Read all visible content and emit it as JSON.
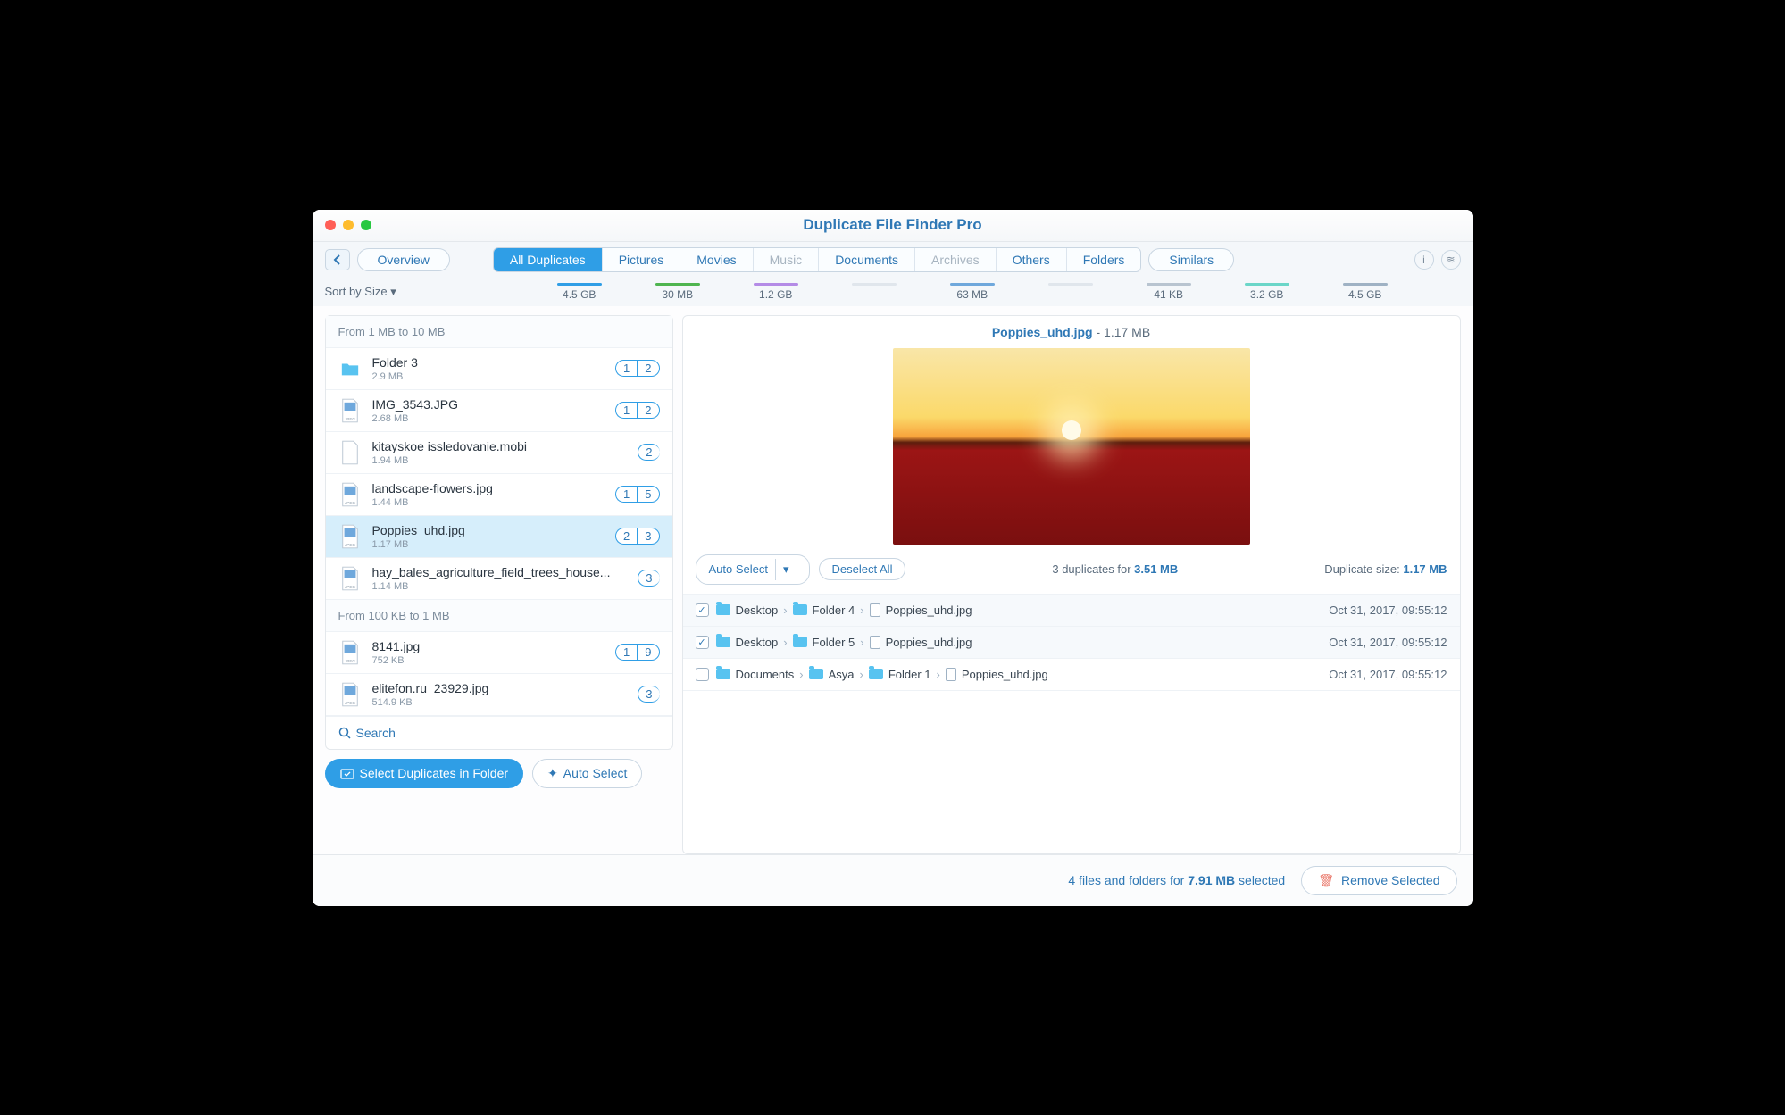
{
  "window": {
    "title": "Duplicate File Finder Pro"
  },
  "toolbar": {
    "overview": "Overview",
    "similars": "Similars",
    "tabs": [
      {
        "label": "All Duplicates",
        "size": "4.5 GB",
        "color": "#2f9ee6",
        "active": true
      },
      {
        "label": "Pictures",
        "size": "30 MB",
        "color": "#4fb54f"
      },
      {
        "label": "Movies",
        "size": "1.2 GB",
        "color": "#b48be6"
      },
      {
        "label": "Music",
        "size": "",
        "color": "#e0e6ec",
        "dim": true
      },
      {
        "label": "Documents",
        "size": "63 MB",
        "color": "#6fa8dc"
      },
      {
        "label": "Archives",
        "size": "",
        "color": "#e0e6ec",
        "dim": true
      },
      {
        "label": "Others",
        "size": "41 KB",
        "color": "#b8c4d0"
      },
      {
        "label": "Folders",
        "size": "3.2 GB",
        "color": "#6bd6c8"
      }
    ],
    "similars_size": "4.5 GB",
    "sort": "Sort by Size"
  },
  "sidebar": {
    "groups": [
      {
        "header": "From 1 MB to 10 MB",
        "items": [
          {
            "name": "Folder 3",
            "size": "2.9 MB",
            "type": "folder",
            "badge": [
              "1",
              "2"
            ]
          },
          {
            "name": "IMG_3543.JPG",
            "size": "2.68 MB",
            "type": "jpeg",
            "badge": [
              "1",
              "2"
            ]
          },
          {
            "name": "kitayskoe issledovanie.mobi",
            "size": "1.94 MB",
            "type": "doc",
            "badge": [
              "2"
            ]
          },
          {
            "name": "landscape-flowers.jpg",
            "size": "1.44 MB",
            "type": "jpeg",
            "badge": [
              "1",
              "5"
            ]
          },
          {
            "name": "Poppies_uhd.jpg",
            "size": "1.17 MB",
            "type": "jpeg",
            "badge": [
              "2",
              "3"
            ],
            "selected": true
          },
          {
            "name": "hay_bales_agriculture_field_trees_house...",
            "size": "1.14 MB",
            "type": "jpeg",
            "badge": [
              "3"
            ]
          }
        ]
      },
      {
        "header": "From 100 KB to 1 MB",
        "items": [
          {
            "name": "8141.jpg",
            "size": "752 KB",
            "type": "jpeg",
            "badge": [
              "1",
              "9"
            ]
          },
          {
            "name": "elitefon.ru_23929.jpg",
            "size": "514.9 KB",
            "type": "jpeg",
            "badge": [
              "3"
            ]
          }
        ]
      }
    ],
    "search": "Search",
    "select_folder": "Select Duplicates in Folder",
    "auto_select": "Auto Select"
  },
  "detail": {
    "filename": "Poppies_uhd.jpg",
    "filesize": "1.17 MB",
    "auto_select": "Auto Select",
    "deselect": "Deselect All",
    "count_text_a": "3 duplicates for ",
    "count_text_b": "3.51 MB",
    "dup_size_label": "Duplicate size: ",
    "dup_size": "1.17 MB",
    "rows": [
      {
        "checked": true,
        "path": [
          "Desktop",
          "Folder 4",
          "Poppies_uhd.jpg"
        ],
        "date": "Oct 31, 2017, 09:55:12"
      },
      {
        "checked": true,
        "path": [
          "Desktop",
          "Folder 5",
          "Poppies_uhd.jpg"
        ],
        "date": "Oct 31, 2017, 09:55:12"
      },
      {
        "checked": false,
        "path": [
          "Documents",
          "Asya",
          "Folder 1",
          "Poppies_uhd.jpg"
        ],
        "date": "Oct 31, 2017, 09:55:12"
      }
    ]
  },
  "footer": {
    "status_a": "4 files and folders for ",
    "status_b": "7.91 MB",
    "status_c": " selected",
    "remove": "Remove Selected"
  }
}
